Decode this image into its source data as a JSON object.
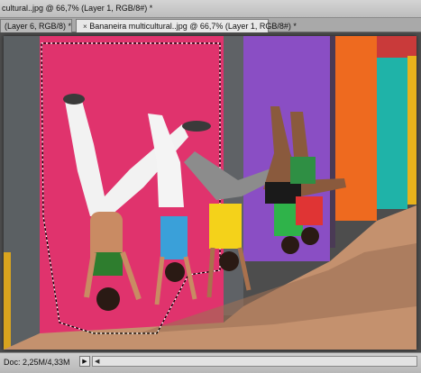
{
  "window": {
    "title": "cultural..jpg @ 66,7% (Layer 1, RGB/8#) *"
  },
  "tabs": [
    {
      "label": "(Layer 6, RGB/8) *",
      "close": "×"
    },
    {
      "label": "Bananeira multicultural..jpg @ 66,7% (Layer 1, RGB/8#) *",
      "close": "×"
    }
  ],
  "status": {
    "doc_info": "Doc: 2,25M/4,33M",
    "arrow": "▶",
    "scroll_left": "◀"
  },
  "colors": {
    "pink_wall": "#e0336d",
    "gray_wall": "#5b6063",
    "purple_wall": "#8a4ec4",
    "orange_wall": "#ee6a1f",
    "teal_wall": "#1fb3a8",
    "ground": "#c4916e",
    "selection": "marching-ants"
  }
}
